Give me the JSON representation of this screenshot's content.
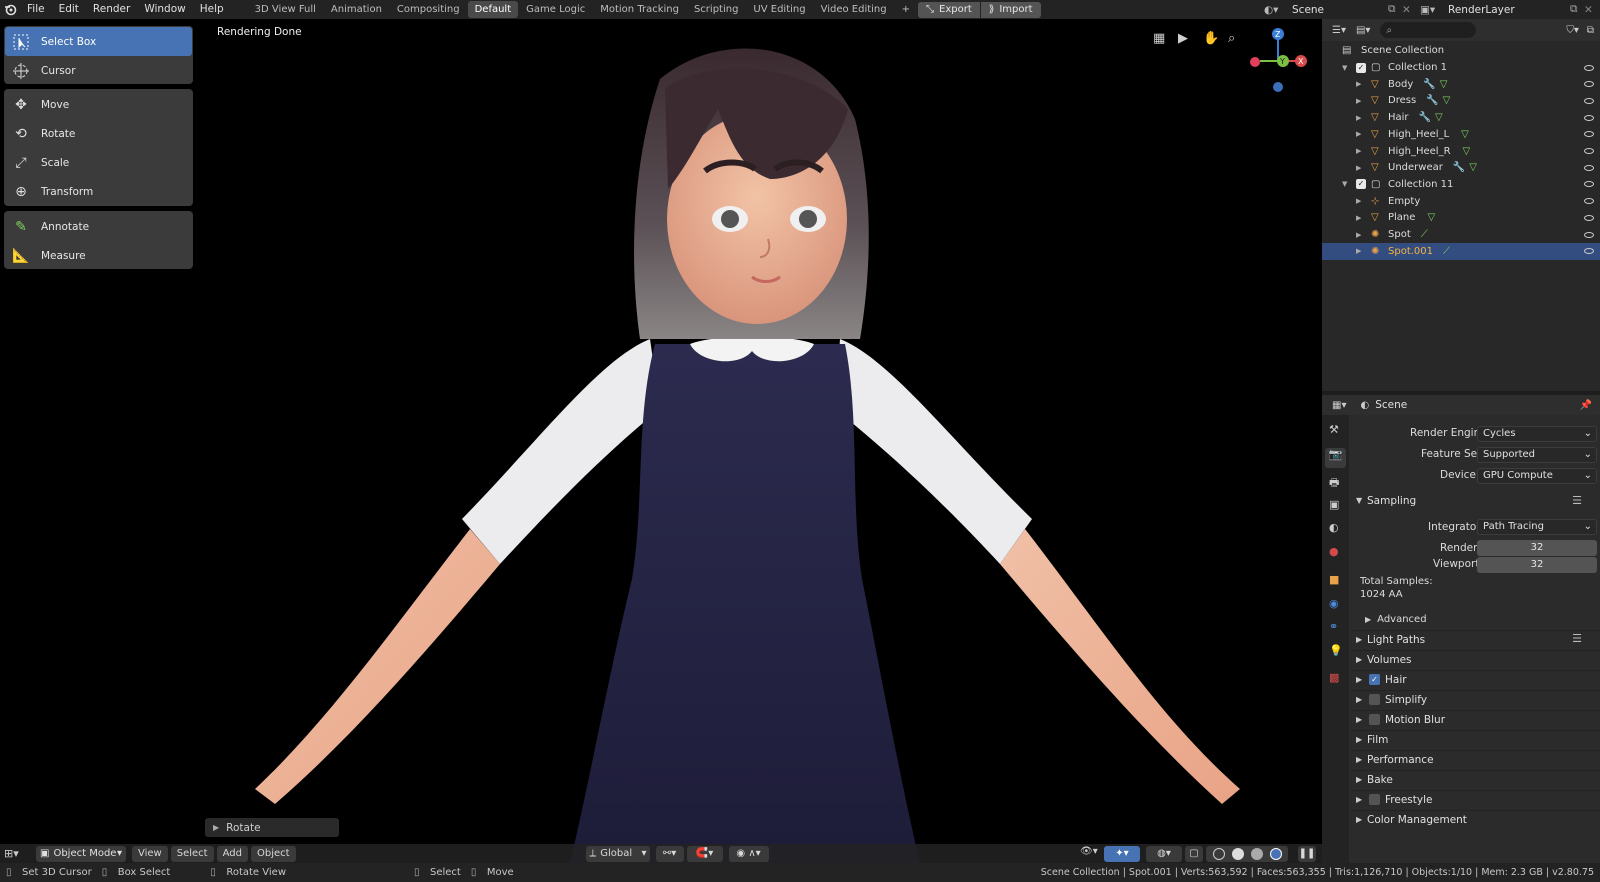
{
  "topbar": {
    "menus": [
      "File",
      "Edit",
      "Render",
      "Window",
      "Help"
    ],
    "workspaces": [
      "3D View Full",
      "Animation",
      "Compositing",
      "Default",
      "Game Logic",
      "Motion Tracking",
      "Scripting",
      "UV Editing",
      "Video Editing"
    ],
    "active_workspace": "Default",
    "add_tab": "+",
    "export_label": "Export",
    "import_label": "Import",
    "scene_name": "Scene",
    "view_layer": "RenderLayer"
  },
  "toolbar": {
    "tools": [
      "Select Box",
      "Cursor",
      "Move",
      "Rotate",
      "Scale",
      "Transform",
      "Annotate",
      "Measure"
    ],
    "active": "Select Box"
  },
  "viewport": {
    "status": "Rendering Done",
    "last_op": "Rotate",
    "mode": "Object Mode",
    "menus": [
      "View",
      "Select",
      "Add",
      "Object"
    ],
    "orientation": "Global",
    "gizmo": {
      "z": "Z",
      "y": "Y",
      "x": "X"
    }
  },
  "outliner": {
    "root": "Scene Collection",
    "rows": [
      {
        "label": "Collection 1",
        "type": "collection",
        "indent": 1
      },
      {
        "label": "Body",
        "type": "mesh",
        "indent": 2
      },
      {
        "label": "Dress",
        "type": "mesh",
        "indent": 2
      },
      {
        "label": "Hair",
        "type": "mesh",
        "indent": 2
      },
      {
        "label": "High_Heel_L",
        "type": "mesh",
        "indent": 2
      },
      {
        "label": "High_Heel_R",
        "type": "mesh",
        "indent": 2
      },
      {
        "label": "Underwear",
        "type": "mesh",
        "indent": 2
      },
      {
        "label": "Collection 11",
        "type": "collection",
        "indent": 1
      },
      {
        "label": "Empty",
        "type": "empty",
        "indent": 2
      },
      {
        "label": "Plane",
        "type": "mesh",
        "indent": 2
      },
      {
        "label": "Spot",
        "type": "light",
        "indent": 2
      },
      {
        "label": "Spot.001",
        "type": "light",
        "indent": 2,
        "selected": true
      }
    ]
  },
  "properties": {
    "context": "Scene",
    "render_engine_label": "Render Engine",
    "render_engine": "Cycles",
    "feature_set_label": "Feature Set",
    "feature_set": "Supported",
    "device_label": "Device",
    "device": "GPU Compute",
    "sampling": "Sampling",
    "integrator_label": "Integrator",
    "integrator": "Path Tracing",
    "render_label": "Render",
    "render_samples": "32",
    "viewport_label": "Viewport",
    "viewport_samples": "32",
    "total_samples_label": "Total Samples:",
    "total_samples": "1024 AA",
    "advanced": "Advanced",
    "panels": [
      {
        "label": "Light Paths"
      },
      {
        "label": "Volumes"
      },
      {
        "label": "Hair",
        "checkbox": true,
        "checked": true
      },
      {
        "label": "Simplify",
        "checkbox": true,
        "checked": false
      },
      {
        "label": "Motion Blur",
        "checkbox": true,
        "checked": false
      },
      {
        "label": "Film"
      },
      {
        "label": "Performance"
      },
      {
        "label": "Bake"
      },
      {
        "label": "Freestyle",
        "checkbox": true,
        "checked": false
      },
      {
        "label": "Color Management"
      }
    ]
  },
  "statusbar": {
    "left1": "Set 3D Cursor",
    "left2": "Box Select",
    "left3": "Rotate View",
    "mid1": "Select",
    "mid2": "Move",
    "info": "Scene Collection | Spot.001 | Verts:563,592 | Faces:563,355 | Tris:1,126,710 | Objects:1/10 | Mem: 2.3 GB | v2.80.75"
  },
  "colors": {
    "accent": "#4772b3",
    "mesh_icon": "#e8a24a",
    "data_icon": "#7ed35e"
  }
}
